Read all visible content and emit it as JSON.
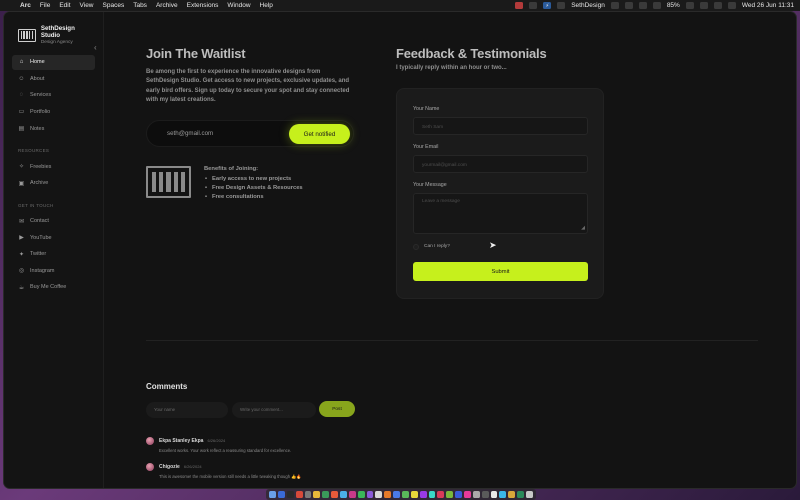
{
  "menubar": {
    "apple_glyph": "",
    "items": [
      "Arc",
      "File",
      "Edit",
      "View",
      "Spaces",
      "Tabs",
      "Archive",
      "Extensions",
      "Window",
      "Help"
    ],
    "tray_label": "SethDesign",
    "battery": "85%",
    "datetime": "Wed 26 Jun  11:31"
  },
  "sidebar": {
    "brand_name": "SethDesign Studio",
    "brand_sub": "Design Agency",
    "collapse_glyph": "‹",
    "main_items": [
      {
        "label": "Home",
        "icon": "home-icon",
        "glyph": "⌂",
        "active": true
      },
      {
        "label": "About",
        "icon": "user-icon",
        "glyph": "☺"
      },
      {
        "label": "Services",
        "icon": "chat-icon",
        "glyph": "◌"
      },
      {
        "label": "Portfolio",
        "icon": "briefcase-icon",
        "glyph": "▭"
      },
      {
        "label": "Notes",
        "icon": "note-icon",
        "glyph": "▤"
      }
    ],
    "resources_heading": "RESOURCES",
    "resource_items": [
      {
        "label": "Freebies",
        "icon": "sparkle-icon",
        "glyph": "✧"
      },
      {
        "label": "Archive",
        "icon": "archive-icon",
        "glyph": "▣"
      }
    ],
    "touch_heading": "GET IN TOUCH",
    "touch_items": [
      {
        "label": "Contact",
        "icon": "mail-icon",
        "glyph": "✉"
      },
      {
        "label": "YouTube",
        "icon": "youtube-icon",
        "glyph": "▶"
      },
      {
        "label": "Twitter",
        "icon": "twitter-icon",
        "glyph": "✦"
      },
      {
        "label": "Instagram",
        "icon": "instagram-icon",
        "glyph": "◎"
      },
      {
        "label": "Buy Me Coffee",
        "icon": "coffee-icon",
        "glyph": "☕"
      }
    ]
  },
  "waitlist": {
    "title": "Join The Waitlist",
    "description": "Be among the first to experience the innovative designs from SethDesign Studio. Get access to new projects, exclusive updates, and early bird offers. Sign up today to secure your spot and stay connected with my latest creations.",
    "email_value": "seth@gmail.com",
    "notify_label": "Get notified",
    "benefits_title": "Benefits of Joining:",
    "benefits": [
      "Early access to new projects",
      "Free Design Assets & Resources",
      "Free consultations"
    ]
  },
  "feedback": {
    "title": "Feedback & Testimonials",
    "subtitle": "I typically reply within an hour or two...",
    "name_label": "Your Name",
    "name_placeholder": "Seth Sam",
    "email_label": "Your Email",
    "email_placeholder": "yourmail@gmail.com",
    "message_label": "Your Message",
    "message_placeholder": "Leave a message",
    "reply_label": "Can I reply?",
    "submit_label": "Submit"
  },
  "comments": {
    "title": "Comments",
    "name_placeholder": "Your name",
    "comment_placeholder": "Write your comment...",
    "post_label": "Post",
    "items": [
      {
        "author": "Ekpa Stanley Ekpa",
        "date": "6/26/2024",
        "body": "Excellent works. Your work reflect a reassuring standard for excellence."
      },
      {
        "author": "Chigozie",
        "date": "6/26/2024",
        "body": "This is awesome! the mobile version still needs a little tweaking though 👍🔥"
      }
    ]
  },
  "colors": {
    "accent": "#c6f01c",
    "background": "#131313",
    "card": "#1b1b1b"
  },
  "dock_colors": [
    "#6aa0e8",
    "#3a6ad8",
    "#2a2a2a",
    "#d84a3a",
    "#7a7a7a",
    "#e8b83a",
    "#3a9a5a",
    "#e85a3a",
    "#4ab0e8",
    "#c83a8a",
    "#3ab858",
    "#8a5ad8",
    "#d8d8d8",
    "#e87a2a",
    "#4a7ae8",
    "#5ab85a",
    "#e8d83a",
    "#9a3ae8",
    "#3ad8c8",
    "#d83a5a",
    "#7ab83a",
    "#3a5ad8",
    "#e83a9a",
    "#aaaaaa",
    "#5a5a5a",
    "#e8e8e8",
    "#3ab8e8",
    "#d8a83a",
    "#2a8a5a",
    "#c8c8c8"
  ]
}
